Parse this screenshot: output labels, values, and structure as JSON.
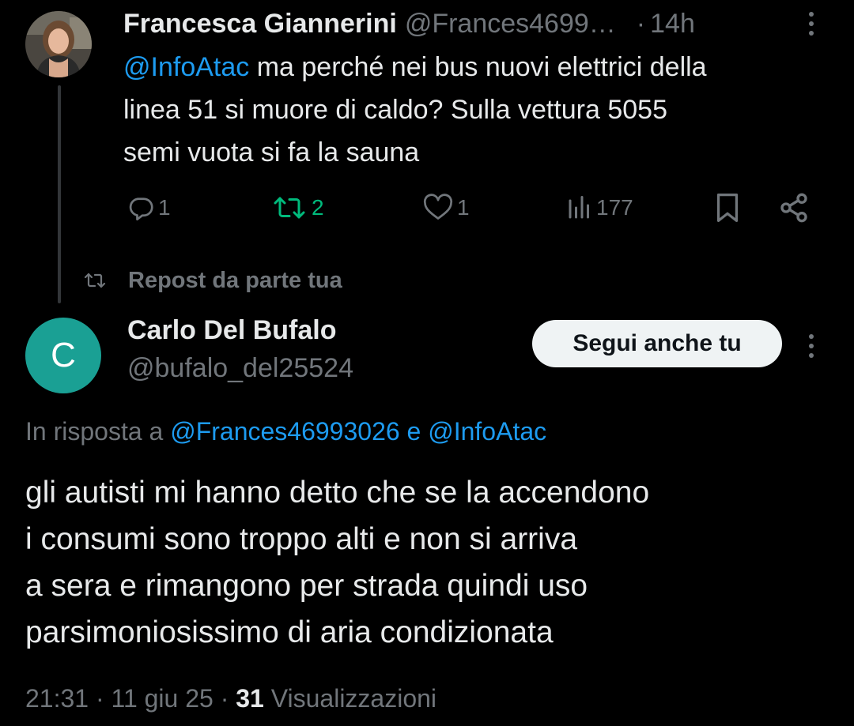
{
  "colors": {
    "background": "#000000",
    "text_primary": "#e7e9ea",
    "text_secondary": "#71767b",
    "link": "#1d9bf0",
    "repost_active": "#00ba7c",
    "avatar_c": "#1aa094"
  },
  "original_tweet": {
    "author_name": "Francesca Giannerini",
    "author_handle": "@Frances4699…",
    "separator": "·",
    "time": "14h",
    "mention": "@InfoAtac",
    "text_rest": " ma perché nei bus nuovi elettrici della\nlinea 51 si muore di caldo? Sulla vettura 5055\nsemi vuota si fa la sauna",
    "actions": {
      "reply": {
        "icon": "reply-icon",
        "count": "1"
      },
      "repost": {
        "icon": "repost-icon",
        "count": "2"
      },
      "like": {
        "icon": "heart-icon",
        "count": "1"
      },
      "views": {
        "icon": "views-icon",
        "count": "177"
      },
      "bookmark": {
        "icon": "bookmark-icon"
      },
      "share": {
        "icon": "share-icon"
      }
    }
  },
  "repost_label": "Repost da parte tua",
  "reply_tweet": {
    "avatar_letter": "C",
    "author_name": "Carlo Del Bufalo",
    "author_handle": "@bufalo_del25524",
    "follow_button": "Segui anche tu",
    "reply_prefix": "In risposta a ",
    "reply_mention_1": "@Frances46993026",
    "reply_joiner": " e ",
    "reply_mention_2": "@InfoAtac",
    "text": "gli autisti mi hanno detto che se la accendono\ni consumi sono troppo alti e non si arriva\na sera e rimangono per strada quindi uso\nparsimoniosissimo di aria condizionata",
    "time": "21:31",
    "date": "11 giu 25",
    "separator": " · ",
    "views_count": "31",
    "views_label": "Visualizzazioni"
  }
}
